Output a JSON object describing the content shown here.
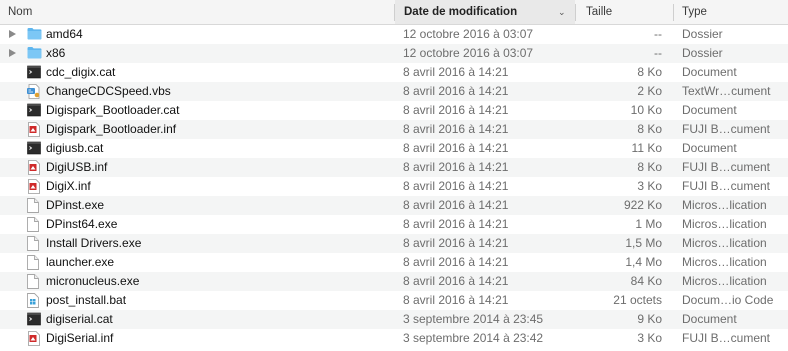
{
  "columns": {
    "name": "Nom",
    "date": "Date de modification",
    "size": "Taille",
    "type": "Type"
  },
  "rows": [
    {
      "name": "amd64",
      "date": "12 octobre 2016 à 03:07",
      "size": "--",
      "type": "Dossier",
      "icon": "folder-icon",
      "expandable": true
    },
    {
      "name": "x86",
      "date": "12 octobre 2016 à 03:07",
      "size": "--",
      "type": "Dossier",
      "icon": "folder-icon",
      "expandable": true
    },
    {
      "name": "cdc_digix.cat",
      "date": "8 avril 2016 à 14:21",
      "size": "8 Ko",
      "type": "Document",
      "icon": "terminal-file-icon"
    },
    {
      "name": "ChangeCDCSpeed.vbs",
      "date": "8 avril 2016 à 14:21",
      "size": "2 Ko",
      "type": "TextWr…cument",
      "icon": "script-file-icon"
    },
    {
      "name": "Digispark_Bootloader.cat",
      "date": "8 avril 2016 à 14:21",
      "size": "10 Ko",
      "type": "Document",
      "icon": "terminal-file-icon"
    },
    {
      "name": "Digispark_Bootloader.inf",
      "date": "8 avril 2016 à 14:21",
      "size": "8 Ko",
      "type": "FUJI B…cument",
      "icon": "fuji-file-icon"
    },
    {
      "name": "digiusb.cat",
      "date": "8 avril 2016 à 14:21",
      "size": "11 Ko",
      "type": "Document",
      "icon": "terminal-file-icon"
    },
    {
      "name": "DigiUSB.inf",
      "date": "8 avril 2016 à 14:21",
      "size": "8 Ko",
      "type": "FUJI B…cument",
      "icon": "fuji-file-icon"
    },
    {
      "name": "DigiX.inf",
      "date": "8 avril 2016 à 14:21",
      "size": "3 Ko",
      "type": "FUJI B…cument",
      "icon": "fuji-file-icon"
    },
    {
      "name": "DPinst.exe",
      "date": "8 avril 2016 à 14:21",
      "size": "922 Ko",
      "type": "Micros…lication",
      "icon": "blank-file-icon"
    },
    {
      "name": "DPinst64.exe",
      "date": "8 avril 2016 à 14:21",
      "size": "1 Mo",
      "type": "Micros…lication",
      "icon": "blank-file-icon"
    },
    {
      "name": "Install Drivers.exe",
      "date": "8 avril 2016 à 14:21",
      "size": "1,5 Mo",
      "type": "Micros…lication",
      "icon": "blank-file-icon"
    },
    {
      "name": "launcher.exe",
      "date": "8 avril 2016 à 14:21",
      "size": "1,4 Mo",
      "type": "Micros…lication",
      "icon": "blank-file-icon"
    },
    {
      "name": "micronucleus.exe",
      "date": "8 avril 2016 à 14:21",
      "size": "84 Ko",
      "type": "Micros…lication",
      "icon": "blank-file-icon"
    },
    {
      "name": "post_install.bat",
      "date": "8 avril 2016 à 14:21",
      "size": "21 octets",
      "type": "Docum…io Code",
      "icon": "windows-file-icon"
    },
    {
      "name": "digiserial.cat",
      "date": "3 septembre 2014 à 23:45",
      "size": "9 Ko",
      "type": "Document",
      "icon": "terminal-file-icon"
    },
    {
      "name": "DigiSerial.inf",
      "date": "3 septembre 2014 à 23:42",
      "size": "3 Ko",
      "type": "FUJI B…cument",
      "icon": "fuji-file-icon"
    }
  ],
  "colors": {
    "folder": "#5fb6ee",
    "alt_row": "#f4f5f5",
    "header_bg": "#f5f5f5",
    "secondary_text": "#6d6d6d"
  }
}
